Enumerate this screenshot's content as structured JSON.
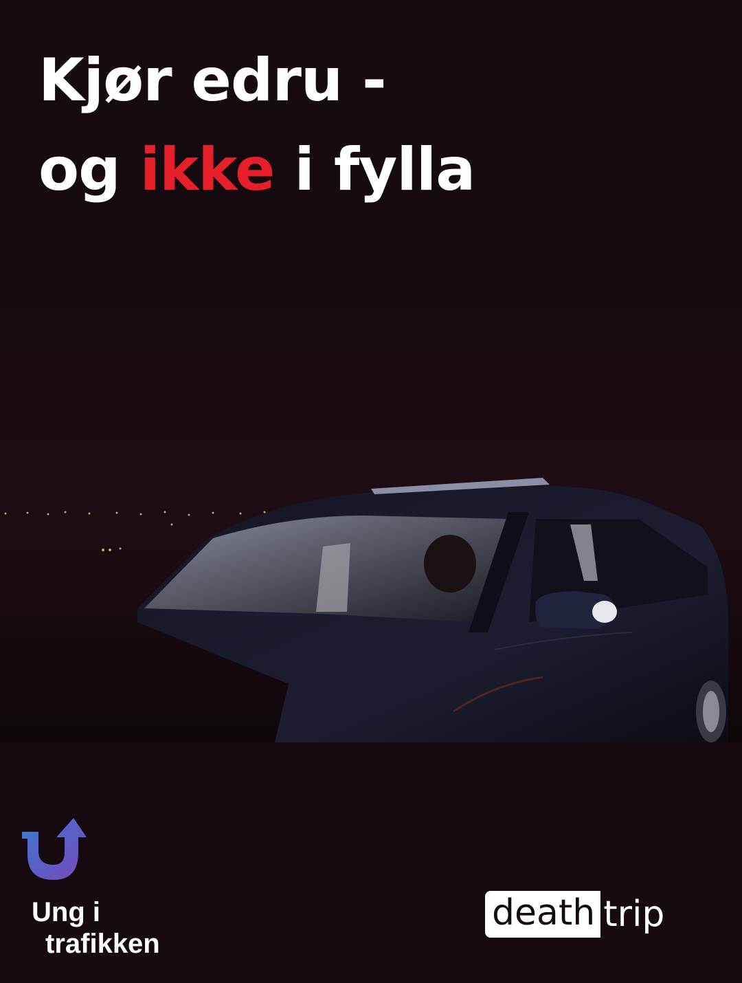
{
  "headline": {
    "line1": "Kjør edru -",
    "line2_start": "og ",
    "line2_accent": "ikke",
    "line2_end": " i fylla"
  },
  "colors": {
    "background": "#140a0f",
    "text": "#ffffff",
    "accent": "#e5202a"
  },
  "photo": {
    "description_icon": "car-at-night-image"
  },
  "ung_logo": {
    "icon": "u-turn-arrow-icon",
    "line1": "Ung i",
    "line2": "trafikken"
  },
  "deathtrip_logo": {
    "part1": "death",
    "part2": "trip"
  }
}
